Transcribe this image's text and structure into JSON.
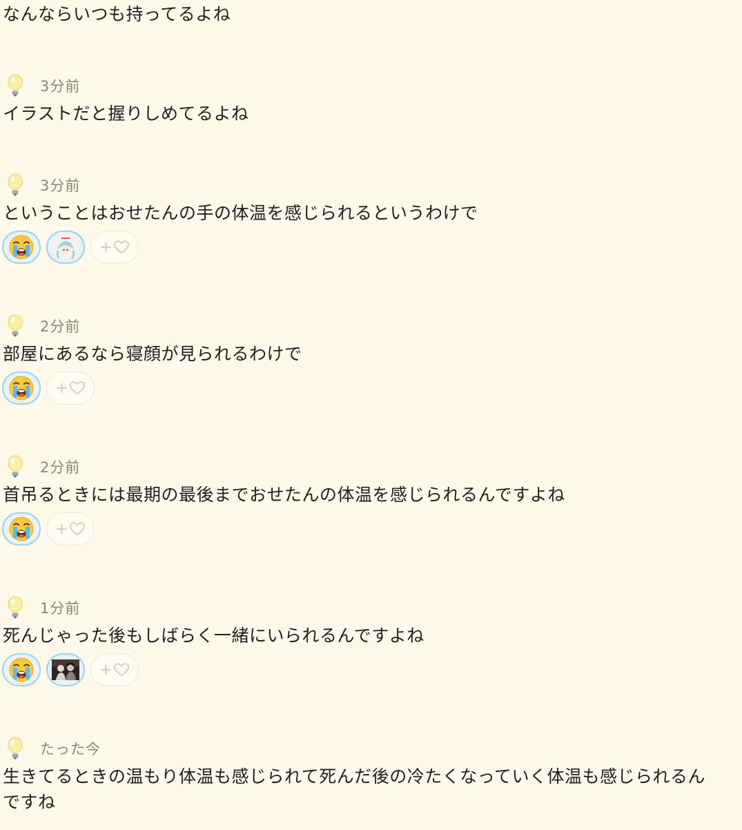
{
  "posts": [
    {
      "time": "",
      "text": "なんならいつも持ってるよね"
    },
    {
      "time": "3分前",
      "text": "イラストだと握りしめてるよね"
    },
    {
      "time": "3分前",
      "text": "ということはおせたんの手の体温を感じられるというわけで"
    },
    {
      "time": "2分前",
      "text": "部屋にあるなら寝顔が見られるわけで"
    },
    {
      "time": "2分前",
      "text": "首吊るときには最期の最後までおせたんの体温を感じられるんですよね"
    },
    {
      "time": "1分前",
      "text": "死んじゃった後もしばらく一緒にいられるんですよね"
    },
    {
      "time": "たった今",
      "text": "生きてるときの温もり体温も感じられて死んだ後の冷たくなっていく体温も感じられるんですね"
    }
  ],
  "reactions": {
    "add_label": "+",
    "crying_icon": "loudly-crying-face-icon",
    "heart_icon": "heart-outline-icon",
    "post_icon": "lightbulb-icon"
  },
  "colors": {
    "background": "#fef9ea",
    "reaction_border": "#9dd1f1",
    "time_text": "#8a8478"
  }
}
